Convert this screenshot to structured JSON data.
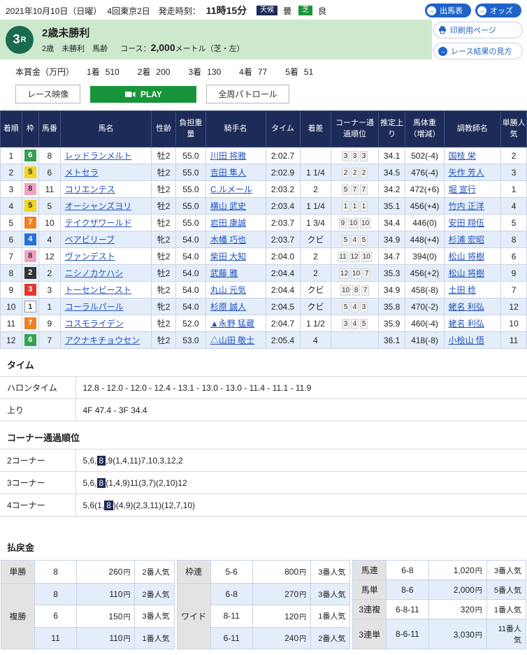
{
  "top_bar": {
    "date": "2021年10月10日（日曜）",
    "meeting": "4回東京2日",
    "start_label": "発走時刻：",
    "start_time": "11時15分",
    "weather_label": "天候",
    "weather_value": "曇",
    "track_label": "芝",
    "track_value": "良",
    "buttons": [
      {
        "label": "出馬表"
      },
      {
        "label": "オッズ"
      }
    ]
  },
  "race_header": {
    "race_number": "3",
    "race_letter": "R",
    "title": "2歳未勝利",
    "conditions": "2歳　未勝利　馬齢",
    "course_label": "コース：",
    "course_value": "2,000",
    "course_suffix": "メートル（芝・左）",
    "print_button": "印刷用ページ",
    "guide_button": "レース結果の見方"
  },
  "prize": {
    "label": "本賞金（万円）",
    "items": [
      {
        "rank": "1着",
        "value": "510"
      },
      {
        "rank": "2着",
        "value": "200"
      },
      {
        "rank": "3着",
        "value": "130"
      },
      {
        "rank": "4着",
        "value": "77"
      },
      {
        "rank": "5着",
        "value": "51"
      }
    ]
  },
  "video_controls": {
    "video_label": "レース映像",
    "play_label": "PLAY",
    "patrol_label": "全周パトロール"
  },
  "frame_colors": {
    "1": {
      "bg": "#ffffff",
      "fg": "#333333",
      "border": "#999999"
    },
    "2": {
      "bg": "#333333",
      "fg": "#ffffff"
    },
    "3": {
      "bg": "#e0392f",
      "fg": "#ffffff"
    },
    "4": {
      "bg": "#2a6fd6",
      "fg": "#ffffff"
    },
    "5": {
      "bg": "#f2d520",
      "fg": "#333333"
    },
    "6": {
      "bg": "#35a14f",
      "fg": "#ffffff"
    },
    "7": {
      "bg": "#ef8122",
      "fg": "#ffffff"
    },
    "8": {
      "bg": "#f0a2c0",
      "fg": "#333333"
    }
  },
  "results_table": {
    "headers": [
      "着順",
      "枠",
      "馬番",
      "馬名",
      "性齢",
      "負担重量",
      "騎手名",
      "タイム",
      "着差",
      "コーナー通過順位",
      "推定上り",
      "馬体重（増減）",
      "調教師名",
      "単勝人気"
    ],
    "rows": [
      {
        "finish": "1",
        "frame": "6",
        "no": "8",
        "name": "レッドランメルト",
        "sex": "牡2",
        "wt": "55.0",
        "jockey": "川田 将雅",
        "time": "2:02.7",
        "margin": "",
        "corners": [
          "3",
          "3",
          "3"
        ],
        "agari": "34.1",
        "hweight": "502(-4)",
        "trainer": "国枝 栄",
        "pop": "2"
      },
      {
        "finish": "2",
        "frame": "5",
        "no": "6",
        "name": "メトセラ",
        "sex": "牡2",
        "wt": "55.0",
        "jockey": "吉田 隼人",
        "time": "2:02.9",
        "margin": "1 1/4",
        "corners": [
          "2",
          "2",
          "2"
        ],
        "agari": "34.5",
        "hweight": "476(-4)",
        "trainer": "矢作 芳人",
        "pop": "3"
      },
      {
        "finish": "3",
        "frame": "8",
        "no": "11",
        "name": "コリエンテス",
        "sex": "牡2",
        "wt": "55.0",
        "jockey": "C.ルメール",
        "time": "2:03.2",
        "margin": "2",
        "corners": [
          "5",
          "7",
          "7"
        ],
        "agari": "34.2",
        "hweight": "472(+6)",
        "trainer": "堀 宣行",
        "pop": "1"
      },
      {
        "finish": "4",
        "frame": "5",
        "no": "5",
        "name": "オーシャンズヨリ",
        "sex": "牡2",
        "wt": "55.0",
        "jockey": "横山 武史",
        "time": "2:03.4",
        "margin": "1 1/4",
        "corners": [
          "1",
          "1",
          "1"
        ],
        "agari": "35.1",
        "hweight": "456(+4)",
        "trainer": "竹内 正洋",
        "pop": "4"
      },
      {
        "finish": "5",
        "frame": "7",
        "no": "10",
        "name": "テイクザワールド",
        "sex": "牡2",
        "wt": "55.0",
        "jockey": "岩田 康誠",
        "time": "2:03.7",
        "margin": "1 3/4",
        "corners": [
          "9",
          "10",
          "10"
        ],
        "agari": "34.4",
        "hweight": "446(0)",
        "trainer": "安田 翔伍",
        "pop": "5"
      },
      {
        "finish": "6",
        "frame": "4",
        "no": "4",
        "name": "ベアビリーブ",
        "sex": "牝2",
        "wt": "54.0",
        "jockey": "木幡 巧也",
        "time": "2:03.7",
        "margin": "クビ",
        "corners": [
          "5",
          "4",
          "5"
        ],
        "agari": "34.9",
        "hweight": "448(+4)",
        "trainer": "杉浦 宏昭",
        "pop": "8"
      },
      {
        "finish": "7",
        "frame": "8",
        "no": "12",
        "name": "ヴァンデスト",
        "sex": "牡2",
        "wt": "54.0",
        "jockey": "柴田 大知",
        "time": "2:04.0",
        "margin": "2",
        "corners": [
          "11",
          "12",
          "10"
        ],
        "agari": "34.7",
        "hweight": "394(0)",
        "trainer": "松山 将樹",
        "pop": "6"
      },
      {
        "finish": "8",
        "frame": "2",
        "no": "2",
        "name": "ニシノカケハシ",
        "sex": "牡2",
        "wt": "54.0",
        "jockey": "武藤 雅",
        "time": "2:04.4",
        "margin": "2",
        "corners": [
          "12",
          "10",
          "7"
        ],
        "agari": "35.3",
        "hweight": "456(+2)",
        "trainer": "松山 将樹",
        "pop": "9"
      },
      {
        "finish": "9",
        "frame": "3",
        "no": "3",
        "name": "トーセンビースト",
        "sex": "牝2",
        "wt": "54.0",
        "jockey": "丸山 元気",
        "time": "2:04.4",
        "margin": "クビ",
        "corners": [
          "10",
          "8",
          "7"
        ],
        "agari": "34.9",
        "hweight": "458(-8)",
        "trainer": "土田 稔",
        "pop": "7"
      },
      {
        "finish": "10",
        "frame": "1",
        "no": "1",
        "name": "コーラルパール",
        "sex": "牝2",
        "wt": "54.0",
        "jockey": "杉原 誠人",
        "time": "2:04.5",
        "margin": "クビ",
        "corners": [
          "5",
          "4",
          "3"
        ],
        "agari": "35.8",
        "hweight": "470(-2)",
        "trainer": "蛯名 利弘",
        "pop": "12"
      },
      {
        "finish": "11",
        "frame": "7",
        "no": "9",
        "name": "コスモライデン",
        "sex": "牡2",
        "wt": "52.0",
        "jockey": "▲永野 猛蔵",
        "time": "2:04.7",
        "margin": "1 1/2",
        "corners": [
          "3",
          "4",
          "5"
        ],
        "agari": "35.9",
        "hweight": "460(-4)",
        "trainer": "蛯名 利弘",
        "pop": "10"
      },
      {
        "finish": "12",
        "frame": "6",
        "no": "7",
        "name": "アクナキチョウセン",
        "sex": "牡2",
        "wt": "53.0",
        "jockey": "△山田 敬士",
        "time": "2:05.4",
        "margin": "4",
        "corners": [],
        "agari": "36.1",
        "hweight": "418(-8)",
        "trainer": "小桧山 悟",
        "pop": "11"
      }
    ]
  },
  "time_section": {
    "title": "タイム",
    "rows": [
      {
        "label": "ハロンタイム",
        "value": "12.8 - 12.0 - 12.0 - 12.4 - 13.1 - 13.0 - 13.0 - 11.4 - 11.1 - 11.9"
      },
      {
        "label": "上り",
        "value": "4F 47.4 - 3F 34.4"
      }
    ]
  },
  "corner_section": {
    "title": "コーナー通過順位",
    "rows": [
      {
        "label": "2コーナー",
        "segments": [
          {
            "t": "5,6,"
          },
          {
            "t": "8",
            "hl": true
          },
          {
            "t": ",9(1,4,11)7,10,3,12,2"
          }
        ]
      },
      {
        "label": "3コーナー",
        "segments": [
          {
            "t": "5,6,"
          },
          {
            "t": "8",
            "hl": true
          },
          {
            "t": "(1,4,9)11(3,7)(2,10)12"
          }
        ]
      },
      {
        "label": "4コーナー",
        "segments": [
          {
            "t": "5,6(1,"
          },
          {
            "t": "8",
            "hl": true
          },
          {
            "t": ")(4,9)(2,3,11)(12,7,10)"
          }
        ]
      }
    ]
  },
  "payout_section": {
    "title": "払戻金",
    "currency_suffix": "円",
    "tables": [
      {
        "rows": [
          {
            "label": "単勝",
            "rowspan": 1,
            "combo": "8",
            "amount": "260",
            "pop": "2番人気"
          },
          {
            "label": "複勝",
            "rowspan": 3,
            "combo": "8",
            "amount": "110",
            "pop": "2番人気"
          },
          {
            "combo": "6",
            "amount": "150",
            "pop": "3番人気"
          },
          {
            "combo": "11",
            "amount": "110",
            "pop": "1番人気"
          }
        ]
      },
      {
        "rows": [
          {
            "label": "枠連",
            "rowspan": 1,
            "combo": "5-6",
            "amount": "800",
            "pop": "3番人気"
          },
          {
            "label": "ワイド",
            "rowspan": 3,
            "combo": "6-8",
            "amount": "270",
            "pop": "3番人気"
          },
          {
            "combo": "8-11",
            "amount": "120",
            "pop": "1番人気"
          },
          {
            "combo": "6-11",
            "amount": "240",
            "pop": "2番人気"
          }
        ]
      },
      {
        "rows": [
          {
            "label": "馬連",
            "rowspan": 1,
            "combo": "6-8",
            "amount": "1,020",
            "pop": "3番人気"
          },
          {
            "label": "馬単",
            "rowspan": 1,
            "combo": "8-6",
            "amount": "2,000",
            "pop": "5番人気"
          },
          {
            "label": "3連複",
            "rowspan": 1,
            "combo": "6-8-11",
            "amount": "320",
            "pop": "1番人気"
          },
          {
            "label": "3連単",
            "rowspan": 1,
            "combo": "8-6-11",
            "amount": "3,030",
            "pop": "11番人気"
          }
        ]
      }
    ]
  }
}
